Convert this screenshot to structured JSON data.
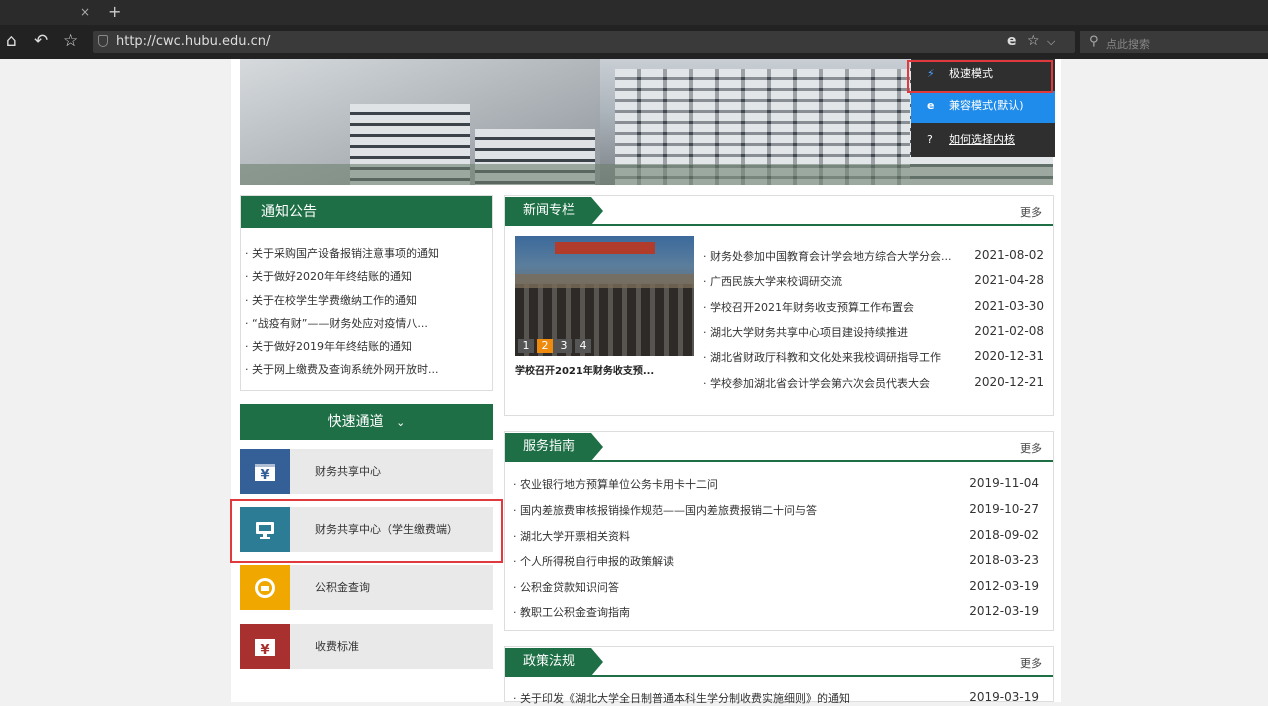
{
  "browser": {
    "tab_close": "×",
    "new_tab": "+",
    "url": "http://cwc.hubu.edu.cn/",
    "search_placeholder": "点此搜索"
  },
  "notices": {
    "title": "通知公告",
    "items": [
      "· 关于采购国产设备报销注意事项的通知",
      "· 关于做好2020年年终结账的通知",
      "· 关于在校学生学费缴纳工作的通知",
      "· “战疫有财”——财务处应对疫情八...",
      "· 关于做好2019年年终结账的通知",
      "· 关于网上缴费及查询系统外网开放时..."
    ]
  },
  "quick": {
    "title": "快速通道",
    "cards": [
      {
        "label": "财务共享中心",
        "icon": "yuan-icon",
        "color": "#355f97"
      },
      {
        "label": "财务共享中心（学生缴费端）",
        "icon": "monitor-icon",
        "color": "#2b7c94"
      },
      {
        "label": "公积金查询",
        "icon": "coin-icon",
        "color": "#f0a800"
      },
      {
        "label": "收费标准",
        "icon": "yuan-icon",
        "color": "#a8302e"
      }
    ]
  },
  "news": {
    "title": "新闻专栏",
    "more": "更多",
    "slider": [
      "1",
      "2",
      "3",
      "4"
    ],
    "active_slide": "2",
    "caption": "学校召开2021年财务收支预...",
    "items": [
      {
        "title": "· 财务处参加中国教育会计学会地方综合大学分会...",
        "date": "2021-08-02"
      },
      {
        "title": "· 广西民族大学来校调研交流",
        "date": "2021-04-28"
      },
      {
        "title": "· 学校召开2021年财务收支预算工作布置会",
        "date": "2021-03-30"
      },
      {
        "title": "· 湖北大学财务共享中心项目建设持续推进",
        "date": "2021-02-08"
      },
      {
        "title": "· 湖北省财政厅科教和文化处来我校调研指导工作",
        "date": "2020-12-31"
      },
      {
        "title": "· 学校参加湖北省会计学会第六次会员代表大会",
        "date": "2020-12-21"
      }
    ]
  },
  "service": {
    "title": "服务指南",
    "more": "更多",
    "items": [
      {
        "title": "· 农业银行地方预算单位公务卡用卡十二问",
        "date": "2019-11-04"
      },
      {
        "title": "· 国内差旅费审核报销操作规范——国内差旅费报销二十问与答",
        "date": "2019-10-27"
      },
      {
        "title": "· 湖北大学开票相关资料",
        "date": "2018-09-02"
      },
      {
        "title": "· 个人所得税自行申报的政策解读",
        "date": "2018-03-23"
      },
      {
        "title": "· 公积金贷款知识问答",
        "date": "2012-03-19"
      },
      {
        "title": "· 教职工公积金查询指南",
        "date": "2012-03-19"
      }
    ]
  },
  "policy": {
    "title": "政策法规",
    "more": "更多",
    "items": [
      {
        "title": "· 关于印发《湖北大学全日制普通本科生学分制收费实施细则》的通知",
        "date": "2019-03-19"
      }
    ]
  },
  "mode_menu": {
    "items": [
      {
        "label": "极速模式",
        "icon": "lightning-icon"
      },
      {
        "label": "兼容模式(默认)",
        "icon": "ie-icon"
      },
      {
        "label": "如何选择内核",
        "icon": "help-icon"
      }
    ],
    "highlight_color": "#1f8ceb"
  }
}
